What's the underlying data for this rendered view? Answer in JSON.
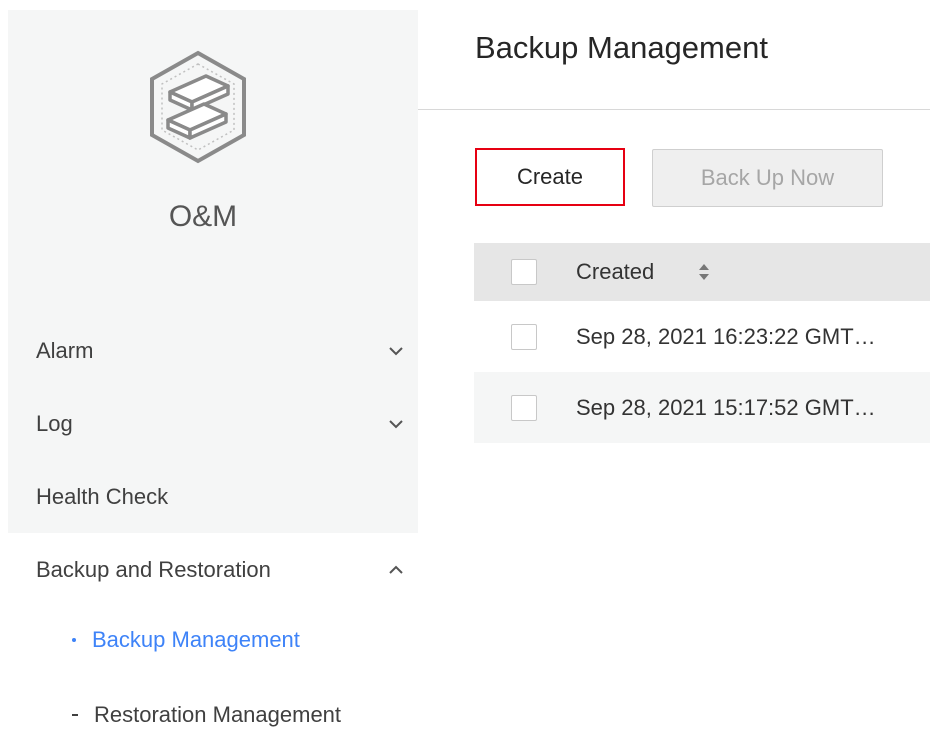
{
  "app": {
    "name": "O&M",
    "logo_icon": "stacked-layers-hexagon-icon"
  },
  "sidebar": {
    "items": [
      {
        "label": "Alarm",
        "icon": "chevron-down-icon"
      },
      {
        "label": "Log",
        "icon": "chevron-down-icon"
      },
      {
        "label": "Health Check"
      },
      {
        "label": "Backup and Restoration",
        "icon": "chevron-up-icon"
      }
    ],
    "subitems": [
      {
        "label": "Backup Management",
        "active": true
      },
      {
        "label": "Restoration Management",
        "active": false
      }
    ],
    "active_color": "#3e83f8"
  },
  "main": {
    "title": "Backup Management",
    "buttons": {
      "create": "Create",
      "backup_now": "Back Up Now"
    },
    "highlight_color": "#e60012",
    "table": {
      "columns": [
        {
          "label": "Created",
          "sortable": true
        }
      ],
      "rows": [
        {
          "created": "Sep 28, 2021 16:23:22 GMT…"
        },
        {
          "created": "Sep 28, 2021 15:17:52 GMT…"
        }
      ]
    }
  }
}
